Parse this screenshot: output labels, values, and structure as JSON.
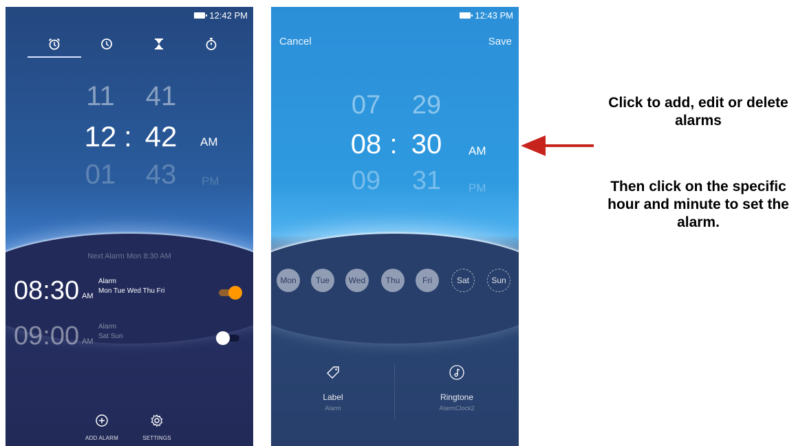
{
  "phone1": {
    "status_time": "12:42 PM",
    "tabs": [
      {
        "icon": "alarm-clock-icon",
        "active": true
      },
      {
        "icon": "clock-icon",
        "active": false
      },
      {
        "icon": "hourglass-icon",
        "active": false
      },
      {
        "icon": "stopwatch-icon",
        "active": false
      }
    ],
    "picker": {
      "prev": {
        "hour": "11",
        "minute": "41"
      },
      "current": {
        "hour": "12",
        "minute": "42",
        "ampm": "AM"
      },
      "next": {
        "hour": "01",
        "minute": "43",
        "ampm": "PM"
      },
      "separator": ":"
    },
    "next_alarm": "Next Alarm Mon 8:30 AM",
    "alarms": [
      {
        "time": "08:30",
        "ampm": "AM",
        "label": "Alarm",
        "days": "Mon Tue Wed Thu Fri",
        "enabled": true
      },
      {
        "time": "09:00",
        "ampm": "AM",
        "label": "Alarm",
        "days": "Sat Sun",
        "enabled": false
      }
    ],
    "add_alarm_label": "ADD ALARM",
    "settings_label": "SETTINGS"
  },
  "phone2": {
    "status_time": "12:43 PM",
    "cancel_label": "Cancel",
    "save_label": "Save",
    "picker": {
      "prev": {
        "hour": "07",
        "minute": "29"
      },
      "current": {
        "hour": "08",
        "minute": "30",
        "ampm": "AM"
      },
      "next": {
        "hour": "09",
        "minute": "31",
        "ampm": "PM"
      },
      "separator": ":"
    },
    "days": [
      {
        "label": "Mon",
        "selected": true
      },
      {
        "label": "Tue",
        "selected": true
      },
      {
        "label": "Wed",
        "selected": true
      },
      {
        "label": "Thu",
        "selected": true
      },
      {
        "label": "Fri",
        "selected": true
      },
      {
        "label": "Sat",
        "selected": false
      },
      {
        "label": "Sun",
        "selected": false
      }
    ],
    "label_option": {
      "title": "Label",
      "value": "Alarm"
    },
    "ringtone_option": {
      "title": "Ringtone",
      "value": "AlarmClock2"
    }
  },
  "annotation": {
    "line1": "Click to add, edit or delete alarms",
    "line2": "Then click on the specific hour and minute to set the alarm.",
    "arrow_color": "#c8241e"
  },
  "colors": {
    "toggle_on": "#ff9800",
    "accent_blue": "#2f9ae0"
  }
}
